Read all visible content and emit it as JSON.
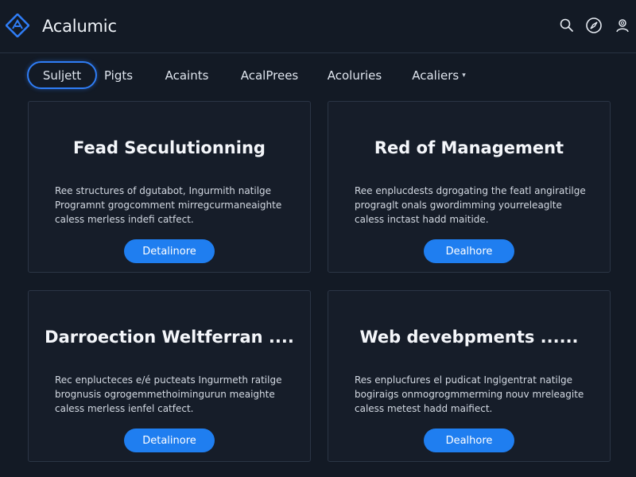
{
  "app": {
    "brand": "Acalumic"
  },
  "nav": {
    "items": [
      {
        "label": "Suljett"
      },
      {
        "label": "Pigts"
      },
      {
        "label": "Acaints"
      },
      {
        "label": "AcalPrees"
      },
      {
        "label": "Acoluries"
      },
      {
        "label": "Acaliers"
      }
    ]
  },
  "cards": [
    {
      "title": "Fead Seculutionning",
      "lines": [
        "Ree structures of dgutabot, Ingurmith natilge",
        "Programnt grogcomment mirregcurmaneaighte",
        "caless merless indefi catfect."
      ],
      "button": "Detalinore"
    },
    {
      "title": "Red of Management",
      "lines": [
        "Ree enplucdests dgrogating the featl angiratilge",
        "prograglt onals gwordimming yourreleaglte",
        "caless inctast hadd maitide."
      ],
      "button": "Dealhore"
    },
    {
      "title": "Darroection Weltferran ....",
      "lines": [
        "Rec enplucteces e/é pucteats Ingurmeth ratilge",
        "brognusis ogrogemmethoimingurun meaighte",
        "caless merless ienfel catfect."
      ],
      "button": "Detalinore"
    },
    {
      "title": "Web devebpments ......",
      "lines": [
        "Res enplucfures el pudicat Inglgentrat natilge",
        "bogiraigs onmogrogmmerming nouv mreleagite",
        "caless metest hadd maifiect."
      ],
      "button": "Dealhore"
    }
  ],
  "colors": {
    "background": "#131a25",
    "card": "#161d29",
    "accent": "#1f7ef0",
    "active_outline": "#2f7df6"
  },
  "icons": [
    "app-logo-icon",
    "search-icon",
    "compass-icon",
    "user-search-icon",
    "chevron-down-icon"
  ]
}
